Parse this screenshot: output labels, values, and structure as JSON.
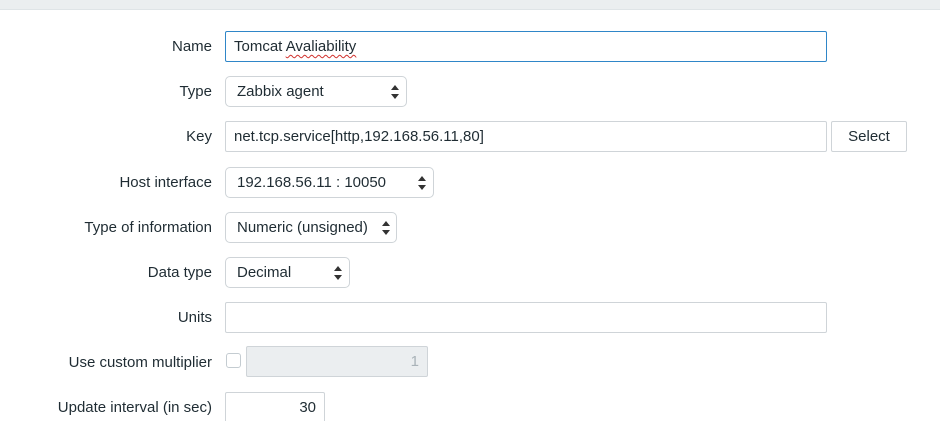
{
  "form": {
    "name": {
      "label": "Name",
      "value_prefix": "Tomcat ",
      "value_misspelled": "Avaliability"
    },
    "type": {
      "label": "Type",
      "selected": "Zabbix agent"
    },
    "key": {
      "label": "Key",
      "value": "net.tcp.service[http,192.168.56.11,80]",
      "select_button": "Select"
    },
    "host_interface": {
      "label": "Host interface",
      "selected": "192.168.56.11 : 10050"
    },
    "type_of_information": {
      "label": "Type of information",
      "selected": "Numeric (unsigned)"
    },
    "data_type": {
      "label": "Data type",
      "selected": "Decimal"
    },
    "units": {
      "label": "Units",
      "value": ""
    },
    "custom_multiplier": {
      "label": "Use custom multiplier",
      "checked": false,
      "value": "1"
    },
    "update_interval": {
      "label": "Update interval (in sec)",
      "value": "30"
    }
  },
  "colors": {
    "focus_border": "#2f86c8",
    "spell_error": "#d0312d",
    "top_bar": "#ebeef0"
  },
  "icons": {
    "select_arrows": "up-down-arrows-icon"
  }
}
